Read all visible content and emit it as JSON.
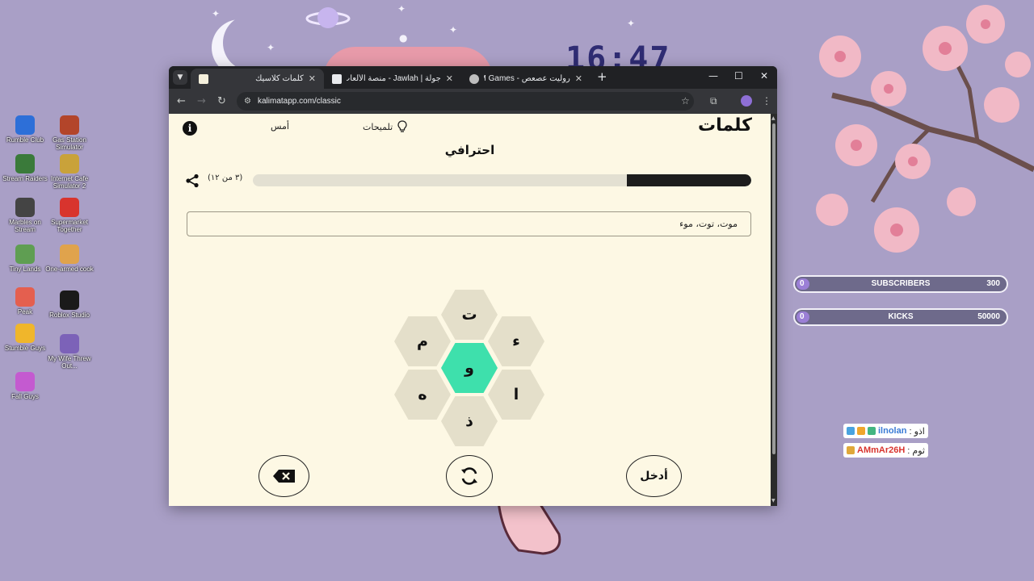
{
  "desktop": {
    "clock": "16:47",
    "icons": [
      {
        "label": "Rumble Club",
        "color": "#2d6fd8"
      },
      {
        "label": "Gas Station Simulator",
        "color": "#b3452a"
      },
      {
        "label": "Stream Raiders",
        "color": "#3a7a3a"
      },
      {
        "label": "Internet Cafe Simulator 2",
        "color": "#c9a23a"
      },
      {
        "label": "Marbles on Stream",
        "color": "#444444"
      },
      {
        "label": "Supermarket Together",
        "color": "#d8342e"
      },
      {
        "label": "Tiny Lands",
        "color": "#5f9e52"
      },
      {
        "label": "One-armed cook",
        "color": "#e0a34c"
      },
      {
        "label": "Peak",
        "color": "#e45f4f"
      },
      {
        "label": "Roblox Studio",
        "color": "#1a1a1a"
      },
      {
        "label": "Stumble Guys",
        "color": "#f0b62b"
      },
      {
        "label": "My Wife Threw Out...",
        "color": "#7c62b8"
      },
      {
        "label": "Fall Guys",
        "color": "#c45ad0"
      }
    ]
  },
  "overlay": {
    "subscribers": {
      "left": "0",
      "label": "SUBSCRIBERS",
      "right": "300"
    },
    "kicks": {
      "left": "0",
      "label": "KICKS",
      "right": "50000"
    },
    "chat": [
      {
        "name": "ilnolan",
        "msg": ": اذو"
      },
      {
        "name": "AMmAr26H",
        "msg": ": ثوم"
      }
    ]
  },
  "browser": {
    "tabs": [
      {
        "title": "كلمات كلاسيك",
        "active": true,
        "favicon_color": "#f5f0dc"
      },
      {
        "title": "جولة | Jawlah - منصة الألعاب الا",
        "active": false,
        "favicon_color": "#e8eaed"
      },
      {
        "title": "روليت عصعص - KM Games",
        "active": false,
        "favicon_color": "#bdbdbd"
      }
    ],
    "url": "kalimatapp.com/classic"
  },
  "app": {
    "logo": "كلمات",
    "hints_label": "تلميحات",
    "yesterday_label": "أمس",
    "rank": "احترافي",
    "found_count": "(٣ من ١٢)",
    "progress_fraction": 0.25,
    "found_words": "موت، توت، موء",
    "letters": {
      "center": "و",
      "top": "ت",
      "top_left": "م",
      "top_right": "ء",
      "bottom_left": "ه",
      "bottom_right": "ا",
      "bottom": "ذ"
    },
    "enter_label": "أدخل",
    "accent_color": "#3ee0ac"
  }
}
